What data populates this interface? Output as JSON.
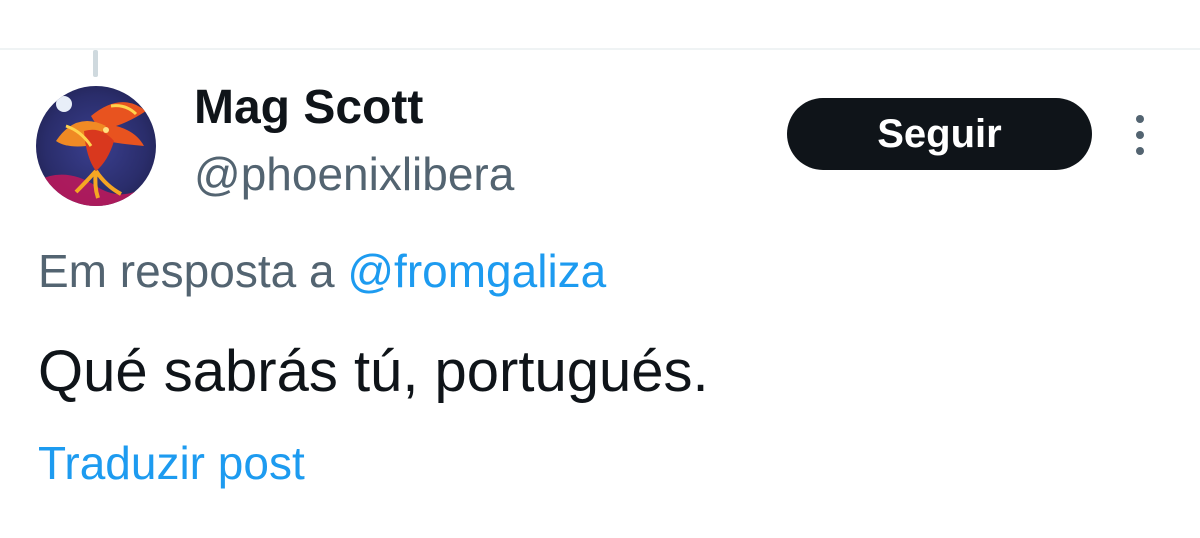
{
  "author": {
    "display_name": "Mag Scott",
    "handle": "@phoenixlibera",
    "avatar_icon": "phoenix-avatar-icon"
  },
  "actions": {
    "follow_label": "Seguir",
    "more_icon": "more-vertical-icon"
  },
  "reply": {
    "prefix": "Em resposta a",
    "mention": "@fromgaliza"
  },
  "post": {
    "text": "Qué sabrás tú, portugués.",
    "translate_label": "Traduzir post"
  },
  "colors": {
    "text_primary": "#0f1419",
    "text_secondary": "#536471",
    "link": "#1d9bf0",
    "follow_bg": "#0f1419",
    "divider": "#eff3f4"
  }
}
